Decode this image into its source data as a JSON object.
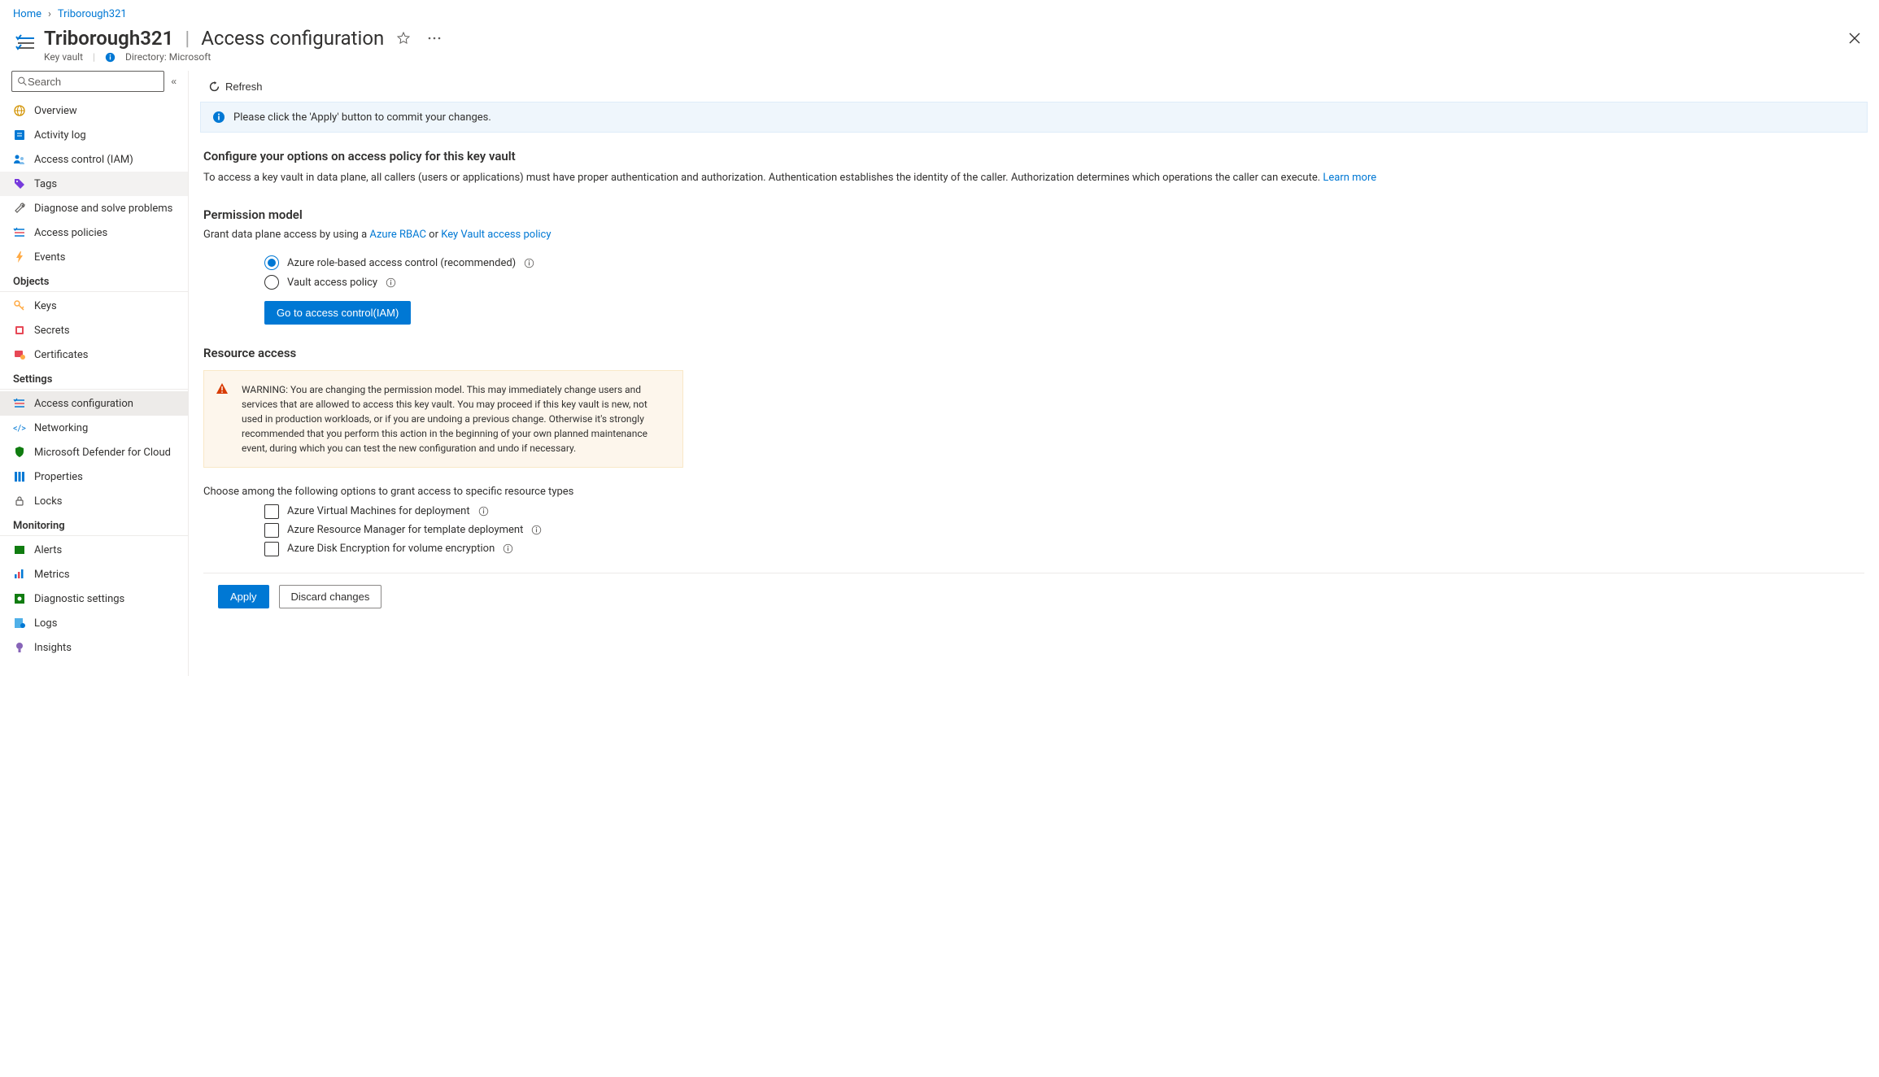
{
  "breadcrumb": {
    "home": "Home",
    "resource": "Triborough321"
  },
  "header": {
    "title": "Triborough321",
    "subtitle": "Access configuration",
    "resource_type": "Key vault",
    "directory_label": "Directory: Microsoft"
  },
  "sidebar": {
    "search_placeholder": "Search",
    "items_top": [
      {
        "label": "Overview",
        "icon": "globe"
      },
      {
        "label": "Activity log",
        "icon": "log"
      },
      {
        "label": "Access control (IAM)",
        "icon": "iam"
      },
      {
        "label": "Tags",
        "icon": "tag",
        "selected_alt": true
      },
      {
        "label": "Diagnose and solve problems",
        "icon": "wrench"
      },
      {
        "label": "Access policies",
        "icon": "policies"
      },
      {
        "label": "Events",
        "icon": "bolt"
      }
    ],
    "group_objects": "Objects",
    "items_objects": [
      {
        "label": "Keys",
        "icon": "key"
      },
      {
        "label": "Secrets",
        "icon": "secret"
      },
      {
        "label": "Certificates",
        "icon": "cert"
      }
    ],
    "group_settings": "Settings",
    "items_settings": [
      {
        "label": "Access configuration",
        "icon": "policies",
        "selected": true
      },
      {
        "label": "Networking",
        "icon": "network"
      },
      {
        "label": "Microsoft Defender for Cloud",
        "icon": "shield"
      },
      {
        "label": "Properties",
        "icon": "props"
      },
      {
        "label": "Locks",
        "icon": "lock"
      }
    ],
    "group_monitoring": "Monitoring",
    "items_monitoring": [
      {
        "label": "Alerts",
        "icon": "alerts"
      },
      {
        "label": "Metrics",
        "icon": "metrics"
      },
      {
        "label": "Diagnostic settings",
        "icon": "diag"
      },
      {
        "label": "Logs",
        "icon": "logs"
      },
      {
        "label": "Insights",
        "icon": "insights"
      }
    ]
  },
  "toolbar": {
    "refresh": "Refresh"
  },
  "banner": {
    "text": "Please click the 'Apply' button to commit your changes."
  },
  "config": {
    "title": "Configure your options on access policy for this key vault",
    "body": "To access a key vault in data plane, all callers (users or applications) must have proper authentication and authorization. Authentication establishes the identity of the caller. Authorization determines which operations the caller can execute. ",
    "learn_more": "Learn more"
  },
  "permission": {
    "heading": "Permission model",
    "lead": "Grant data plane access by using a ",
    "link1": "Azure RBAC",
    "or": "  or  ",
    "link2": "Key Vault access policy",
    "opt1": "Azure role-based access control (recommended)",
    "opt2": "Vault access policy",
    "go_iam": "Go to access control(IAM)"
  },
  "resource": {
    "heading": "Resource access",
    "warning": "WARNING: You are changing the permission model. This may immediately change users and services that are allowed to access this key vault. You may proceed if this key vault is new, not used in production workloads, or if you are undoing a previous change. Otherwise it's strongly recommended that you perform this action in the beginning of your own planned maintenance event, during which you can test the new configuration and undo if necessary.",
    "choose": "Choose among the following options to grant access to specific resource types",
    "cb1": "Azure Virtual Machines for deployment",
    "cb2": "Azure Resource Manager for template deployment",
    "cb3": "Azure Disk Encryption for volume encryption"
  },
  "footer": {
    "apply": "Apply",
    "discard": "Discard changes"
  }
}
